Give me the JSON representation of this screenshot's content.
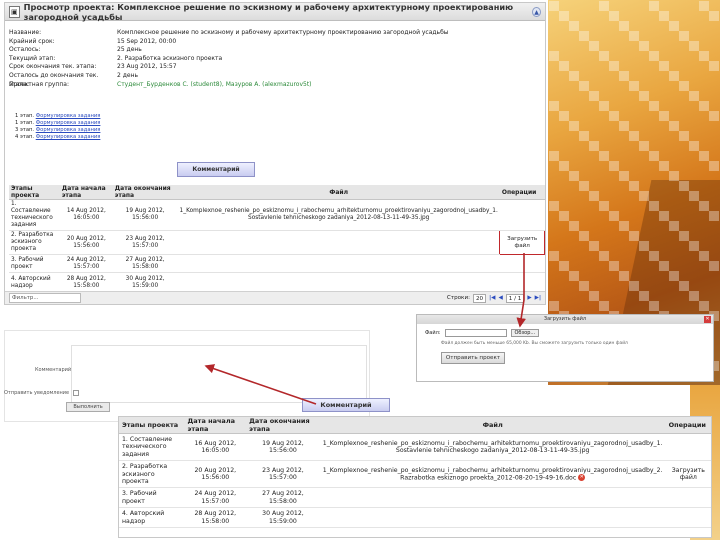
{
  "window": {
    "title": "Просмотр проекта: Комплексное решение по эскизному и рабочему архитектурному проектированию загородной усадьбы",
    "collapse_icon": "chevron-up-icon"
  },
  "info": [
    {
      "k": "Название:",
      "v": "Комплексное решение по эскизному и рабочему архитектурному проектированию загородной усадьбы"
    },
    {
      "k": "Крайний срок:",
      "v": "15 Sep 2012, 00:00"
    },
    {
      "k": "Осталось:",
      "v": "25 день"
    },
    {
      "k": "Текущий этап:",
      "v": "2. Разработка эскизного проекта"
    },
    {
      "k": "Срок окончания тек. этапа:",
      "v": "23 Aug 2012, 15:57"
    },
    {
      "k": "Осталось до окончания тек. этапа:",
      "v": "2 день"
    },
    {
      "k": "Проектная группа:",
      "v": "Студент_Бурденков С. (student8), Мазуров А. (alexmazurov5t)"
    }
  ],
  "stages": [
    {
      "num": "1 этап.",
      "link": "Формулировка задания"
    },
    {
      "num": "1 этап.",
      "link": "Формулировка задания"
    },
    {
      "num": "3 этап.",
      "link": "Формулировка задания"
    },
    {
      "num": "4 этап.",
      "link": "Формулировка задания"
    }
  ],
  "comment_button": "Комментарий",
  "columns": [
    "Этапы проекта",
    "Дата начала этапа",
    "Дата окончания этапа",
    "Файл",
    "Операции"
  ],
  "rows": [
    {
      "stage": "1. Составление технического задания",
      "start": "14 Aug 2012, 16:05:00",
      "end": "19 Aug 2012, 15:56:00",
      "file": "1_Komplexnoe_reshenie_po_eskiznomu_i_rabochemu_arhitekturnomu_proektirovaniyu_zagorodnoj_usadby_1. Sostavlenie tehnicheskogo zadaniya_2012-08-13-11-49-35.jpg",
      "op": ""
    },
    {
      "stage": "2. Разработка эскизного проекта",
      "start": "20 Aug 2012, 15:56:00",
      "end": "23 Aug 2012, 15:57:00",
      "file": "",
      "op": "Загрузить файл"
    },
    {
      "stage": "3. Рабочий проект",
      "start": "24 Aug 2012, 15:57:00",
      "end": "27 Aug 2012, 15:58:00",
      "file": "",
      "op": ""
    },
    {
      "stage": "4. Авторский надзор",
      "start": "28 Aug 2012, 15:58:00",
      "end": "30 Aug 2012, 15:59:00",
      "file": "",
      "op": ""
    }
  ],
  "bottombar": {
    "filter_placeholder": "Фильтр...",
    "pagesize_label": "Строки:",
    "pagesize": "20",
    "page": "1 / 1"
  },
  "comment_window": {
    "label": "Комментарий",
    "checkbox_label": "Отправить уведомление",
    "submit": "Выполнить"
  },
  "upload_window": {
    "title": "Загрузить файл",
    "file_label": "Файл:",
    "browse": "Обзор...",
    "note": "Файл должен быть меньше 65,000 Kb. Вы сможете загрузить только один файл",
    "send": "Отправить проект"
  },
  "comment_button2": "Комментарий",
  "zoom_rows": [
    {
      "stage": "1. Составление технического задания",
      "start": "16 Aug 2012, 16:05:00",
      "end": "19 Aug 2012, 15:56:00",
      "file": "1_Komplexnoe_reshenie_po_eskiznomu_i_rabochemu_arhitekturnomu_proektirovaniyu_zagorodnoj_usadby_1. Sostavlenie tehnicheskogo zadaniya_2012-08-13-11-49-35.jpg",
      "op": "",
      "del": false
    },
    {
      "stage": "2. Разработка эскизного проекта",
      "start": "20 Aug 2012, 15:56:00",
      "end": "23 Aug 2012, 15:57:00",
      "file": "1_Komplexnoe_reshenie_po_eskiznomu_i_rabochemu_arhitekturnomu_proektirovaniyu_zagorodnoj_usadby_2. Razrabotka eskiznogo proekta_2012-08-20-19-49-16.doc",
      "op": "Загрузить файл",
      "del": true
    },
    {
      "stage": "3. Рабочий проект",
      "start": "24 Aug 2012, 15:57:00",
      "end": "27 Aug 2012, 15:58:00",
      "file": "",
      "op": "",
      "del": false
    },
    {
      "stage": "4. Авторский надзор",
      "start": "28 Aug 2012, 15:58:00",
      "end": "30 Aug 2012, 15:59:00",
      "file": "",
      "op": "",
      "del": false
    }
  ],
  "colors": {
    "accent": "#2a4bbf",
    "arrow": "#b3272a",
    "green": "#2c8a3a"
  }
}
